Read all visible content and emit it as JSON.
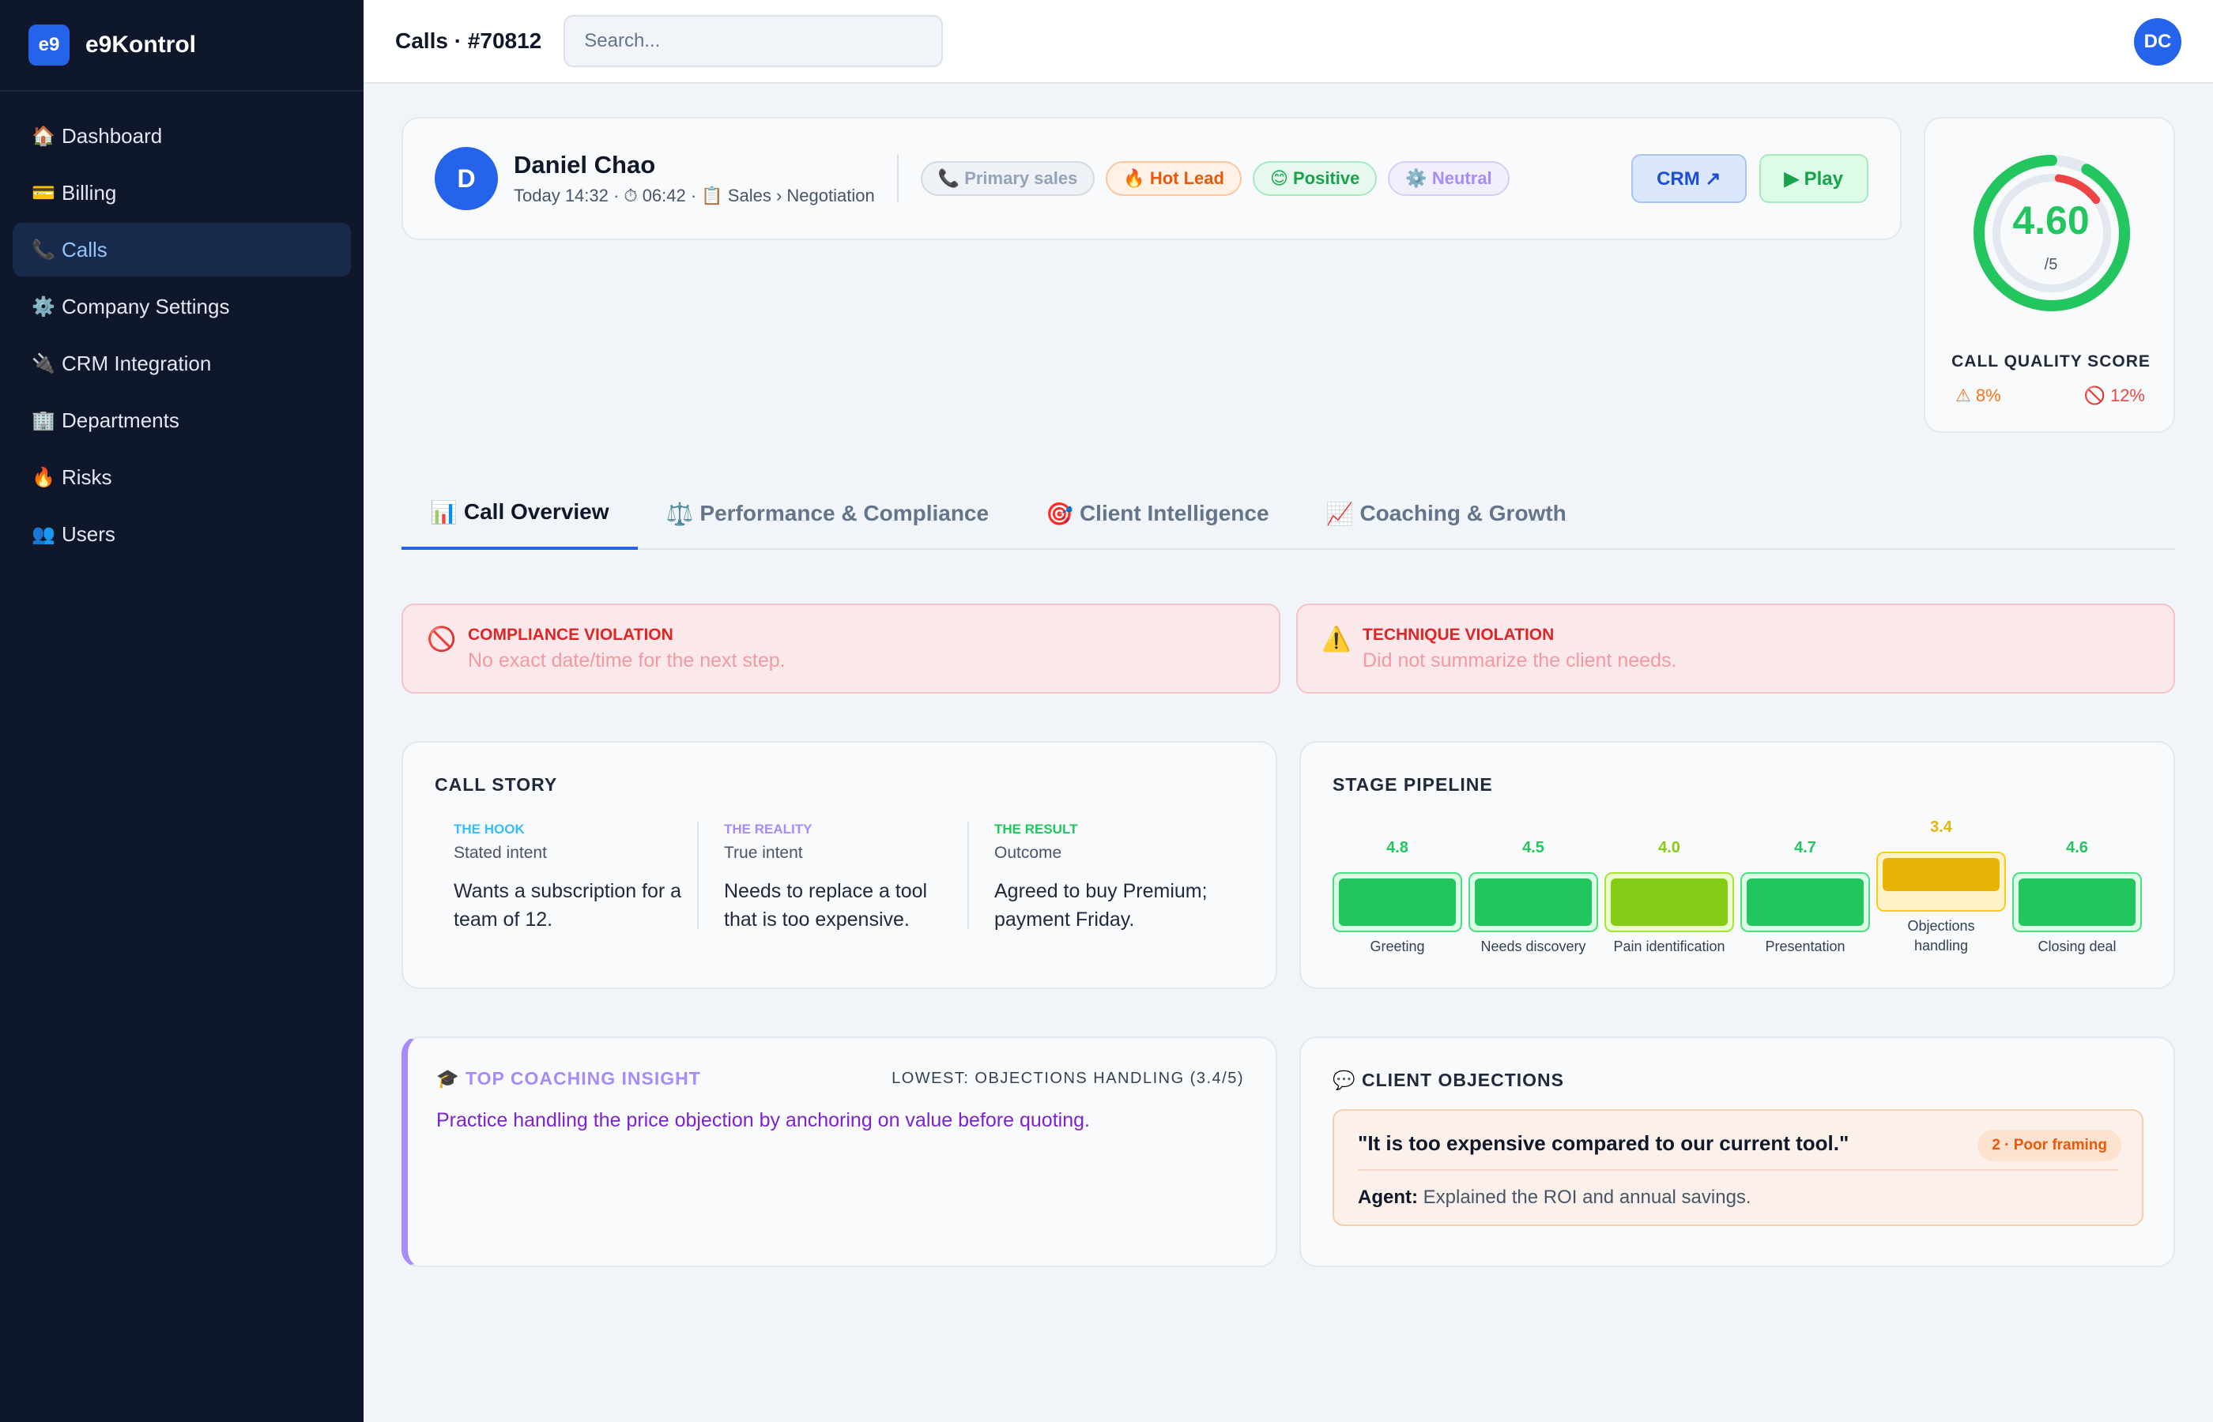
{
  "brand": {
    "logo": "e9",
    "name": "e9Kontrol"
  },
  "sidebar": {
    "items": [
      {
        "icon": "🏠",
        "label": "Dashboard"
      },
      {
        "icon": "💳",
        "label": "Billing"
      },
      {
        "icon": "📞",
        "label": "Calls",
        "active": true
      },
      {
        "icon": "⚙️",
        "label": "Company Settings"
      },
      {
        "icon": "🔌",
        "label": "CRM Integration"
      },
      {
        "icon": "🏢",
        "label": "Departments"
      },
      {
        "icon": "🔥",
        "label": "Risks"
      },
      {
        "icon": "👥",
        "label": "Users"
      }
    ]
  },
  "header": {
    "title": "Calls · #70812",
    "search_placeholder": "Search...",
    "user_initials": "DC"
  },
  "call": {
    "client_initial": "D",
    "client_name": "Daniel Chao",
    "meta": "Today 14:32 · ⏱ 06:42 · 📋 Sales › Negotiation",
    "tags": [
      {
        "label": "📞 Primary sales"
      },
      {
        "label": "🔥 Hot Lead"
      },
      {
        "label": "😊 Positive"
      },
      {
        "label": "⚙️ Neutral"
      }
    ],
    "crm_label": "CRM ↗",
    "play_label": "▶ Play"
  },
  "score": {
    "value": "4.60",
    "max": "/5",
    "value_fraction": 0.92,
    "risk_fraction": 0.08,
    "label": "CALL QUALITY SCORE",
    "warning": "⚠ 8%",
    "violation": "🚫 12%",
    "colors": {
      "good": "#22c55e",
      "bad": "#ef4444",
      "track": "#e2e8f0"
    }
  },
  "tabs": [
    {
      "icon": "📊",
      "label": "Call Overview",
      "active": true
    },
    {
      "icon": "⚖️",
      "label": "Performance & Compliance"
    },
    {
      "icon": "🎯",
      "label": "Client Intelligence"
    },
    {
      "icon": "📈",
      "label": "Coaching & Growth"
    }
  ],
  "violations": [
    {
      "icon": "🚫",
      "title": "COMPLIANCE VIOLATION",
      "text": "No exact date/time for the next step."
    },
    {
      "icon": "⚠️",
      "title": "TECHNIQUE VIOLATION",
      "text": "Did not summarize the client needs."
    }
  ],
  "story": {
    "title": "CALL STORY",
    "columns": [
      {
        "kicker": "THE HOOK",
        "sub": "Stated intent",
        "body": "Wants a subscription for a team of 12.",
        "color": "#38bdf8"
      },
      {
        "kicker": "THE REALITY",
        "sub": "True intent",
        "body": "Needs to replace a tool that is too expensive.",
        "color": "#a78bfa"
      },
      {
        "kicker": "THE RESULT",
        "sub": "Outcome",
        "body": "Agreed to buy Premium; payment Friday.",
        "color": "#22c55e"
      }
    ]
  },
  "pipeline": {
    "title": "STAGE PIPELINE",
    "stages": [
      {
        "score": "4.8",
        "label": "Greeting",
        "fill": "#22c55e",
        "border": "#4ade80",
        "bg": "#dcfce7",
        "text": "#22c55e"
      },
      {
        "score": "4.5",
        "label": "Needs discovery",
        "fill": "#22c55e",
        "border": "#4ade80",
        "bg": "#dcfce7",
        "text": "#22c55e"
      },
      {
        "score": "4.0",
        "label": "Pain identification",
        "fill": "#84cc16",
        "border": "#a3e635",
        "bg": "#ecfccb",
        "text": "#84cc16"
      },
      {
        "score": "4.7",
        "label": "Presentation",
        "fill": "#22c55e",
        "border": "#4ade80",
        "bg": "#dcfce7",
        "text": "#22c55e"
      },
      {
        "score": "3.4",
        "label": "Objections handling",
        "fill": "#eab308",
        "border": "#facc15",
        "bg": "#fef3c7",
        "text": "#eab308",
        "lowest": true
      },
      {
        "score": "4.6",
        "label": "Closing deal",
        "fill": "#22c55e",
        "border": "#4ade80",
        "bg": "#dcfce7",
        "text": "#22c55e"
      }
    ]
  },
  "coaching": {
    "title": "🎓 TOP COACHING INSIGHT",
    "lowest": "LOWEST: OBJECTIONS HANDLING (3.4/5)",
    "text": "Practice handling the price objection by anchoring on value before quoting."
  },
  "objections": {
    "title": "💬 CLIENT OBJECTIONS",
    "quote": "\"It is too expensive compared to our current tool.\"",
    "badge": "2 · Poor framing",
    "agent_label": "Agent:",
    "agent_text": "Explained the ROI and annual savings."
  }
}
